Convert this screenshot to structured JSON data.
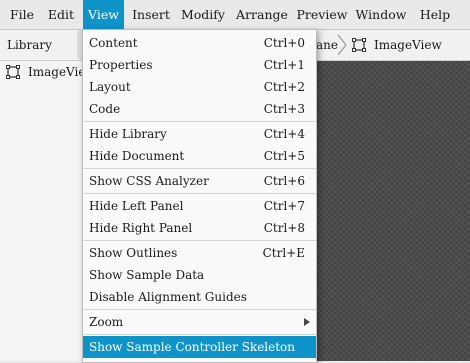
{
  "menubar": {
    "items": [
      "File",
      "Edit",
      "View",
      "Insert",
      "Modify",
      "Arrange",
      "Preview",
      "Window",
      "Help"
    ],
    "active": "View"
  },
  "toolbar": {
    "library_label": "Library",
    "crumb_partial": "ane",
    "crumb_current": "ImageView"
  },
  "library": {
    "items": [
      {
        "label": "ImageView",
        "icon": "image-view-icon"
      }
    ]
  },
  "view_menu": {
    "items": [
      {
        "label": "Content",
        "shortcut": "Ctrl+0"
      },
      {
        "label": "Properties",
        "shortcut": "Ctrl+1"
      },
      {
        "label": "Layout",
        "shortcut": "Ctrl+2"
      },
      {
        "label": "Code",
        "shortcut": "Ctrl+3"
      },
      {
        "label": "Hide Library",
        "shortcut": "Ctrl+4"
      },
      {
        "label": "Hide Document",
        "shortcut": "Ctrl+5"
      },
      {
        "label": "Show CSS Analyzer",
        "shortcut": "Ctrl+6"
      },
      {
        "label": "Hide Left Panel",
        "shortcut": "Ctrl+7"
      },
      {
        "label": "Hide Right Panel",
        "shortcut": "Ctrl+8"
      },
      {
        "label": "Show Outlines",
        "shortcut": "Ctrl+E"
      },
      {
        "label": "Show Sample Data",
        "shortcut": ""
      },
      {
        "label": "Disable Alignment Guides",
        "shortcut": ""
      },
      {
        "label": "Zoom",
        "shortcut": "",
        "submenu": true
      },
      {
        "label": "Show Sample Controller Skeleton",
        "shortcut": "",
        "highlighted": true
      }
    ]
  },
  "colors": {
    "accent": "#0f94c9",
    "menubar_bg": "#e9e9e9",
    "canvas_bg": "#4b4b4b"
  }
}
